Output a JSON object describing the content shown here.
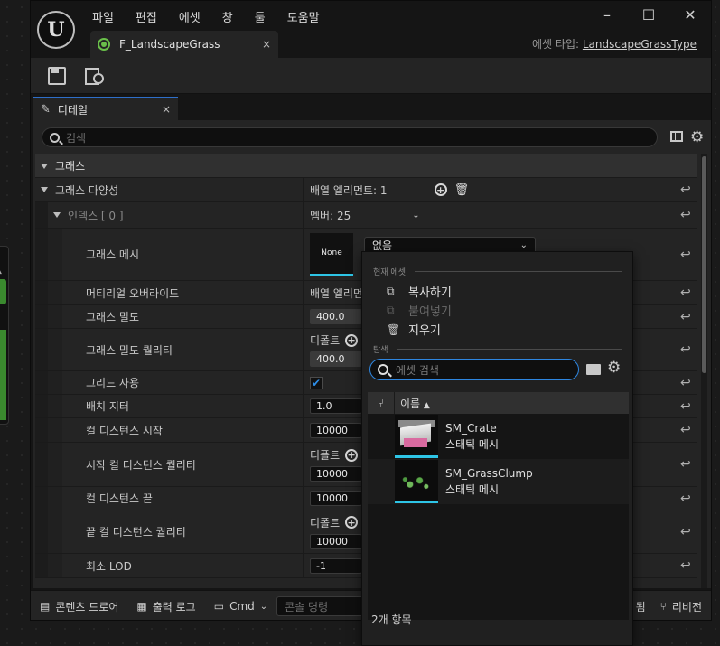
{
  "menu": [
    "파일",
    "편집",
    "에셋",
    "창",
    "툴",
    "도움말"
  ],
  "doc_tab": {
    "label": "F_LandscapeGrass",
    "close": "×"
  },
  "asset_type": {
    "prefix": "에셋 타입:",
    "value": "LandscapeGrassType"
  },
  "panel_tab": {
    "label": "디테일",
    "close": "×"
  },
  "search": {
    "placeholder": "검색"
  },
  "rows": {
    "category": "그래스",
    "variety": {
      "name": "그래스 다양성",
      "value": "배열 엘리먼트: 1"
    },
    "index": {
      "name": "인덱스 [ 0 ]",
      "value": "멤버: 25"
    },
    "mesh": {
      "name": "그래스 메시",
      "thumb": "None",
      "combo": "없음"
    },
    "material_override": {
      "name": "머티리얼 오버라이드",
      "value": "배열 엘리먼트"
    },
    "density": {
      "name": "그래스 밀도",
      "value": "400.0"
    },
    "density_quality": {
      "name": "그래스 밀도 퀄리티",
      "label": "디폴트",
      "value": "400.0"
    },
    "use_grid": {
      "name": "그리드 사용"
    },
    "placement_jitter": {
      "name": "배치 지터",
      "value": "1.0"
    },
    "cull_start": {
      "name": "컬 디스턴스 시작",
      "value": "10000"
    },
    "cull_start_quality": {
      "name": "시작 컬 디스턴스 퀄리티",
      "label": "디폴트",
      "value": "10000"
    },
    "cull_end": {
      "name": "컬 디스턴스 끝",
      "value": "10000"
    },
    "cull_end_quality": {
      "name": "끝 컬 디스턴스 퀄리티",
      "label": "디폴트",
      "value": "10000"
    },
    "min_lod": {
      "name": "최소 LOD",
      "value": "-1"
    }
  },
  "dropdown": {
    "current_header": "현재 에셋",
    "copy": "복사하기",
    "paste": "붙여넣기",
    "clear": "지우기",
    "browse_header": "탐색",
    "search_placeholder": "에셋 검색",
    "column_name": "이름",
    "assets": [
      {
        "name": "SM_Crate",
        "type": "스태틱 메시"
      },
      {
        "name": "SM_GrassClump",
        "type": "스태틱 메시"
      }
    ],
    "count": "2개 항목"
  },
  "status": {
    "content_drawer": "콘텐츠 드로어",
    "output_log": "출력 로그",
    "cmd": "Cmd",
    "console_placeholder": "콘솔 명령",
    "partial": "됨",
    "revision": "리비전"
  },
  "colors": {
    "accent": "#2e6fc9",
    "thumb_border": "#2ec5e6",
    "search_focus": "#2e86e0"
  }
}
